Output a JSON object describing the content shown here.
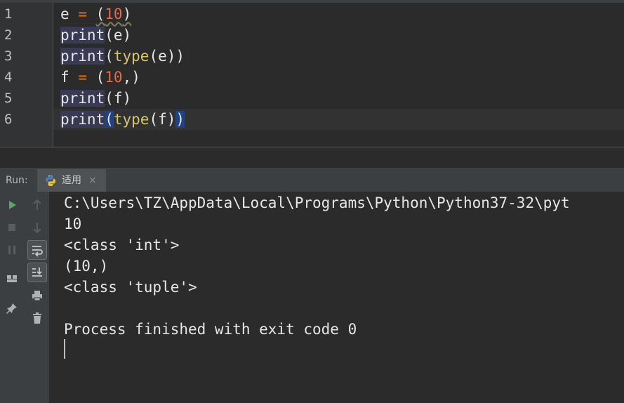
{
  "editor": {
    "line_numbers": [
      "1",
      "2",
      "3",
      "4",
      "5",
      "6"
    ],
    "lines": {
      "l1": {
        "var": "e",
        "eq": "=",
        "open": "(",
        "num": "10",
        "close": ")"
      },
      "l2": {
        "fn": "print",
        "open": "(",
        "arg": "e",
        "close": ")"
      },
      "l3": {
        "fn": "print",
        "open": "(",
        "inner_fn": "type",
        "inner_open": "(",
        "arg": "e",
        "close": "))"
      },
      "l4": {
        "var": "f",
        "eq": "=",
        "open": "(",
        "num": "10",
        "comma_close": ",)"
      },
      "l5": {
        "fn": "print",
        "open": "(",
        "arg": "f",
        "close": ")"
      },
      "l6": {
        "fn": "print",
        "open": "(",
        "inner_fn": "type",
        "inner_open": "(",
        "arg": "f",
        "inner_close": ")",
        "close": ")"
      }
    }
  },
  "run_panel": {
    "label": "Run:",
    "tab": {
      "label": "适用",
      "close": "×",
      "icon": "python-icon"
    },
    "toolbar_icons": [
      "run-icon",
      "stop-icon",
      "pause-icon",
      "scroll-up-icon",
      "scroll-down-icon",
      "soft-wrap-icon",
      "scroll-to-end-icon",
      "layout-icon",
      "print-icon",
      "pin-icon",
      "trash-icon"
    ],
    "output": [
      "C:\\Users\\TZ\\AppData\\Local\\Programs\\Python\\Python37-32\\pyt",
      "10",
      "<class 'int'>",
      "(10,)",
      "<class 'tuple'>",
      "",
      "Process finished with exit code 0"
    ]
  },
  "colors": {
    "background": "#2b2b2b",
    "gutter": "#313335",
    "keyword_highlight": "#3b3a55",
    "builtin": "#d8c66f",
    "number": "#e06c4a",
    "selection": "#214283",
    "run_green": "#59a869"
  }
}
